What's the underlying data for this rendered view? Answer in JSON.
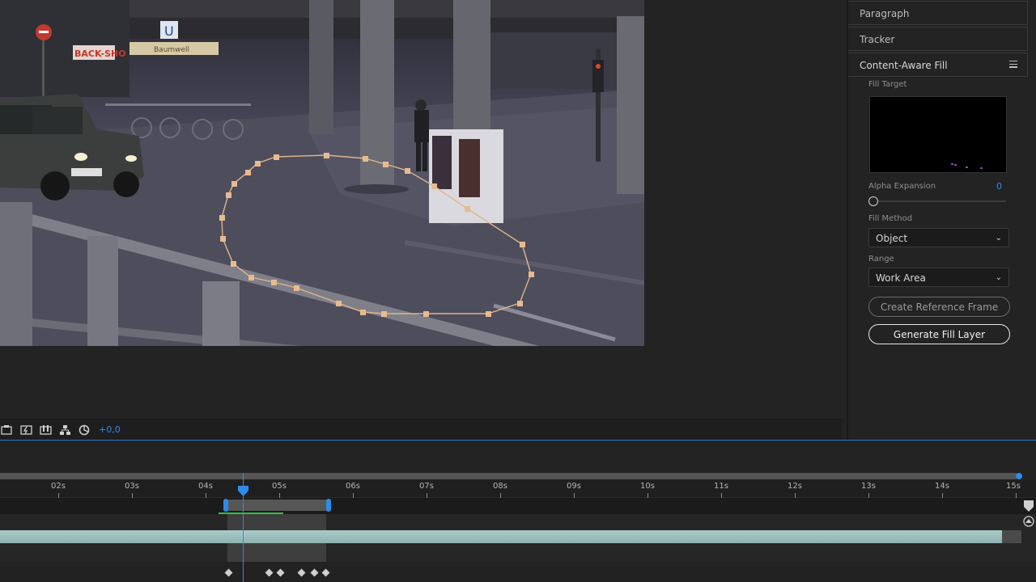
{
  "panel": {
    "tabs": [
      "Paragraph",
      "Tracker",
      "Content-Aware Fill"
    ],
    "fill_target_label": "Fill Target",
    "alpha_expansion_label": "Alpha Expansion",
    "alpha_expansion_value": "0",
    "fill_method_label": "Fill Method",
    "fill_method_value": "Object",
    "range_label": "Range",
    "range_value": "Work Area",
    "create_ref_button": "Create Reference Frame",
    "generate_button": "Generate Fill Layer"
  },
  "viewer_toolbar": {
    "exposure_value": "+0,0"
  },
  "frame_signs": {
    "shop_sign": "BACK-SHO",
    "store_sign": "Baumwell",
    "station_sign": "U"
  },
  "timeline": {
    "ticks": [
      "02s",
      "03s",
      "04s",
      "05s",
      "06s",
      "07s",
      "08s",
      "09s",
      "10s",
      "11s",
      "12s",
      "13s",
      "14s",
      "15s"
    ]
  },
  "colors": {
    "accent_blue": "#2d8ceb",
    "mask_path": "#e0b68c",
    "layer_bar": "#9fc2bf",
    "green_line": "#2ec14b"
  }
}
